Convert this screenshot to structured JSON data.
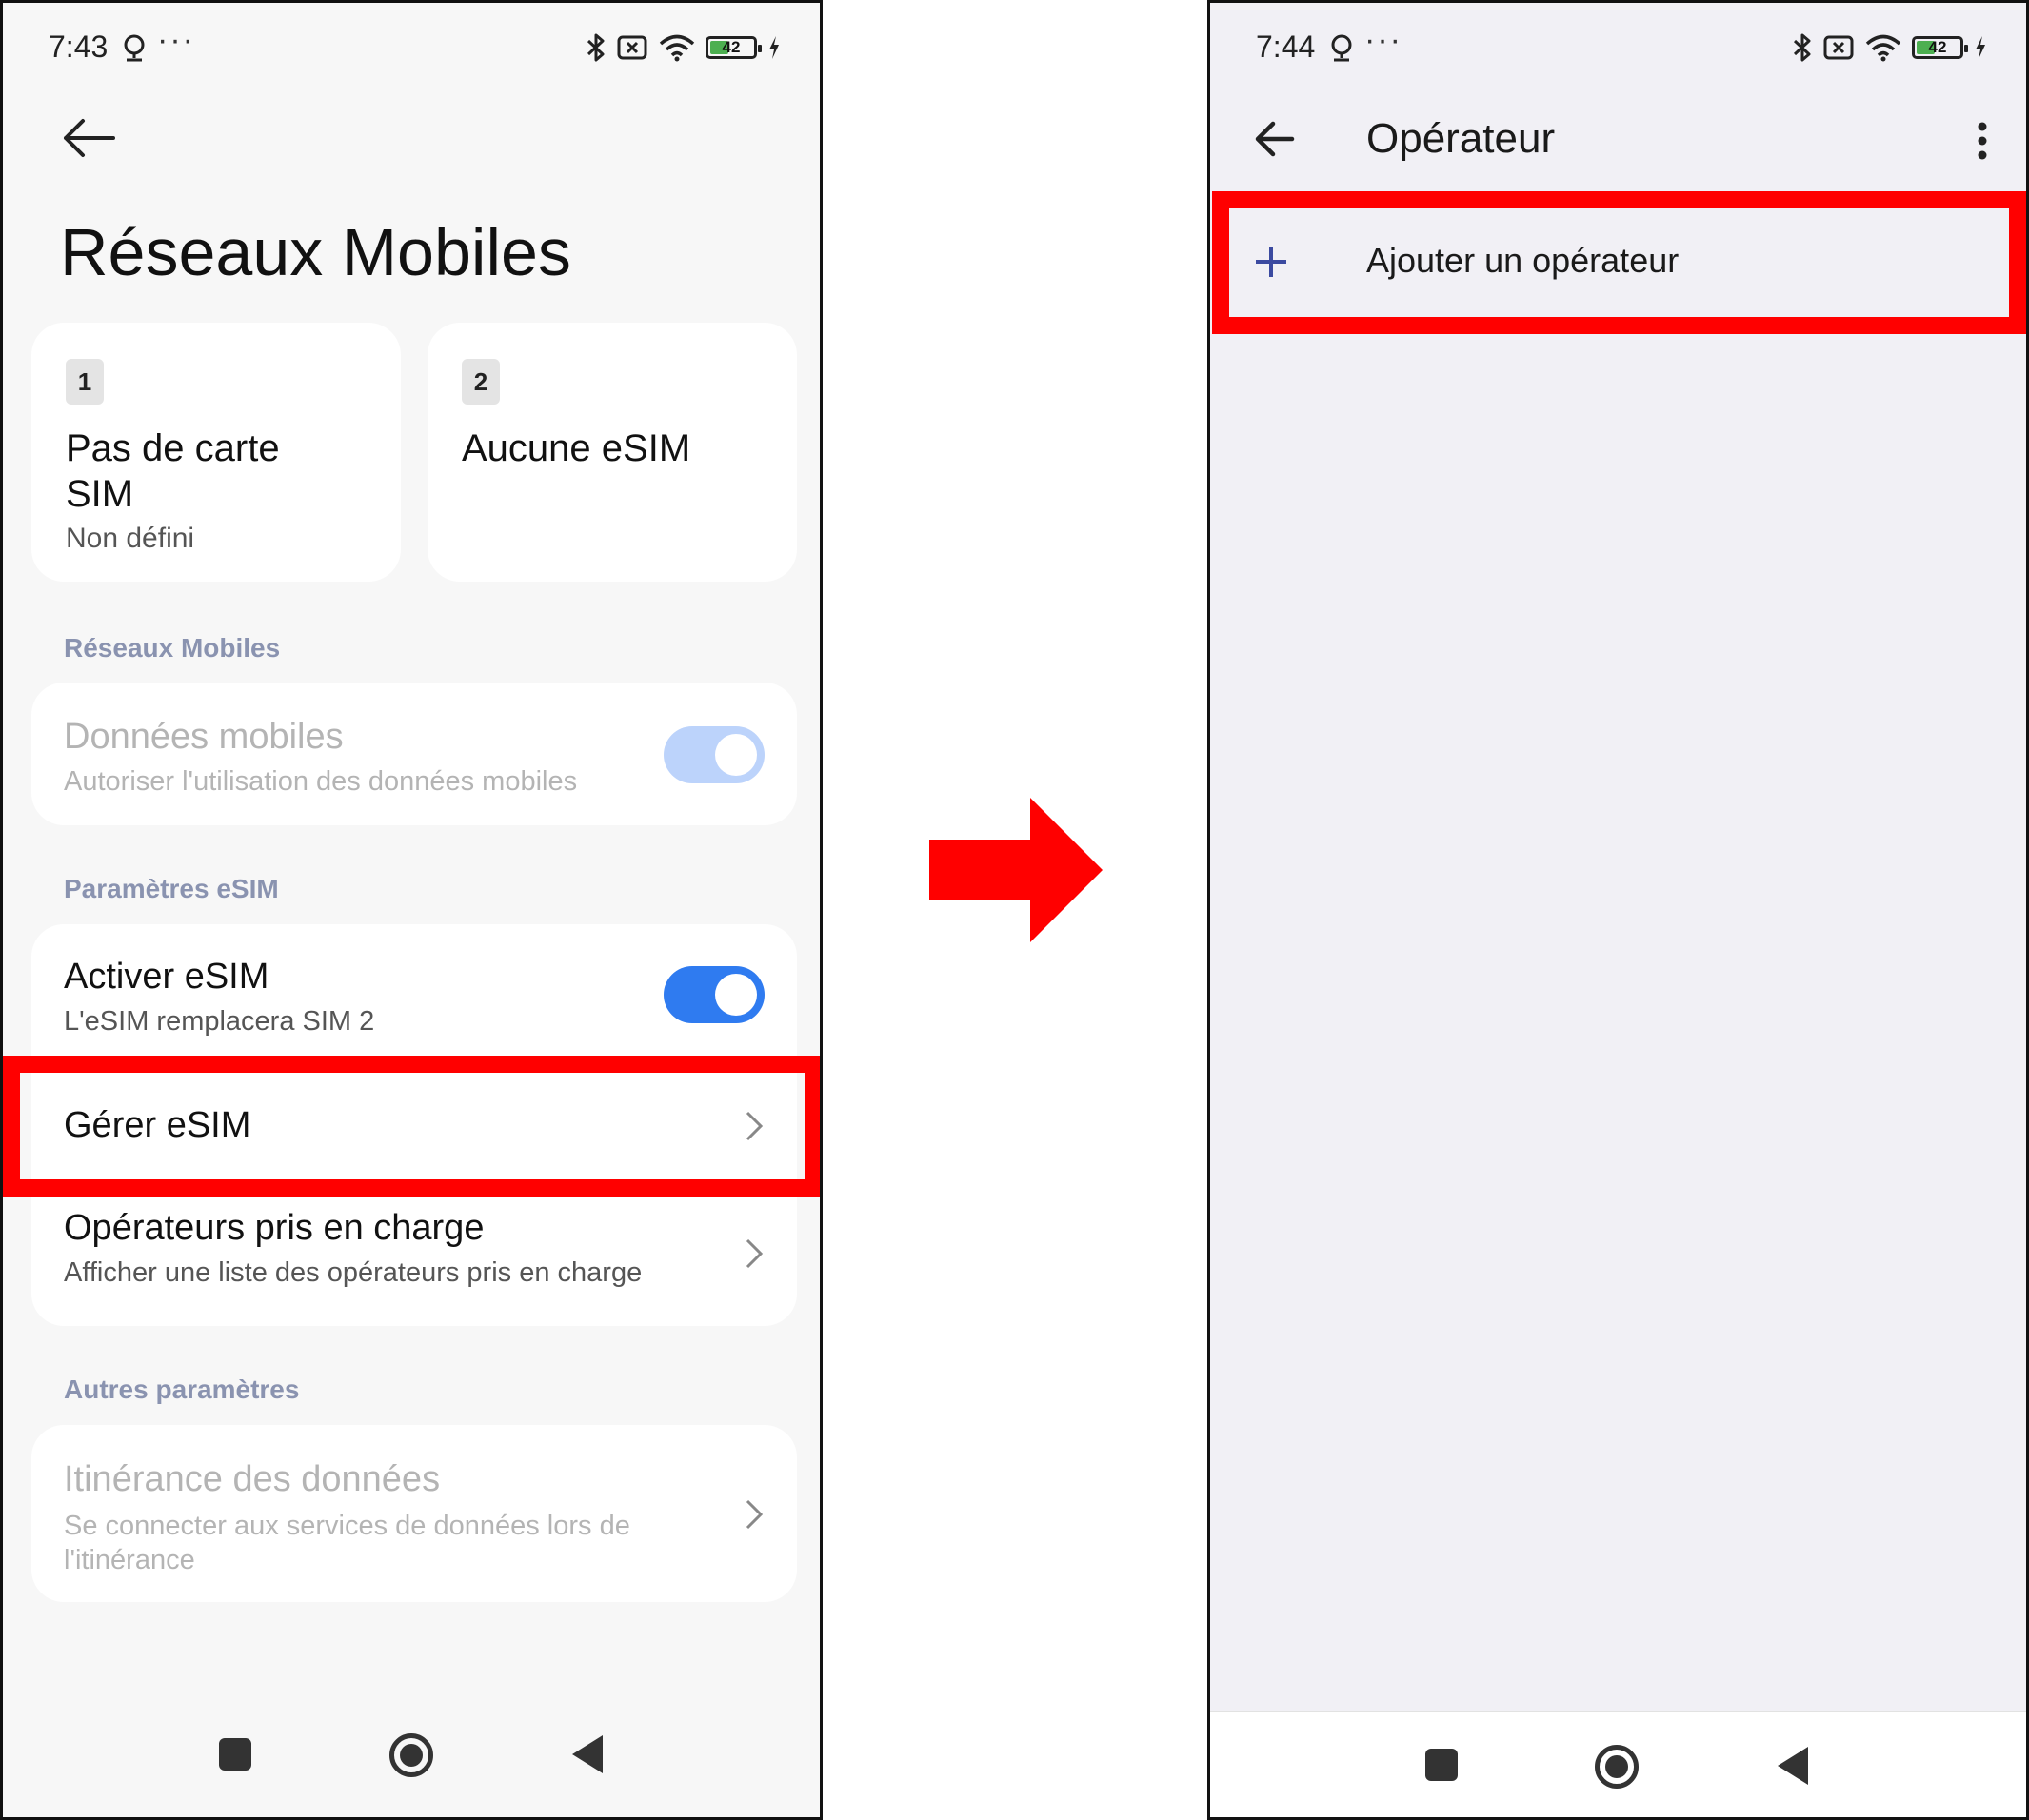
{
  "left_screen": {
    "status": {
      "time": "7:43",
      "dots": "···",
      "battery": "42"
    },
    "title": "Réseaux Mobiles",
    "sim_cards": [
      {
        "number": "1",
        "name": "Pas de carte SIM",
        "status": "Non défini"
      },
      {
        "number": "2",
        "name": "Aucune eSIM",
        "status": ""
      }
    ],
    "sections": {
      "mobile_networks": "Réseaux Mobiles",
      "esim_settings": "Paramètres eSIM",
      "other_settings": "Autres paramètres"
    },
    "mobile_data": {
      "title": "Données mobiles",
      "subtitle": "Autoriser l'utilisation des données mobiles",
      "enabled": false,
      "toggle_on": true
    },
    "activate_esim": {
      "title": "Activer eSIM",
      "subtitle": "L'eSIM remplacera SIM 2",
      "toggle_on": true
    },
    "manage_esim": {
      "title": "Gérer eSIM"
    },
    "supported_operators": {
      "title": "Opérateurs pris en charge",
      "subtitle": "Afficher une liste des opérateurs pris en charge"
    },
    "data_roaming": {
      "title": "Itinérance des données",
      "subtitle": "Se connecter aux services de données lors de l'itinérance",
      "enabled": false
    }
  },
  "right_screen": {
    "status": {
      "time": "7:44",
      "dots": "···",
      "battery": "42"
    },
    "title": "Opérateur",
    "add_operator": "Ajouter un opérateur"
  },
  "colors": {
    "highlight": "#ff0000",
    "toggle_active": "#2f7bf0",
    "toggle_disabled": "#bcd3fb",
    "section_header": "#8a93b0",
    "plus_icon": "#3b4aa0"
  }
}
